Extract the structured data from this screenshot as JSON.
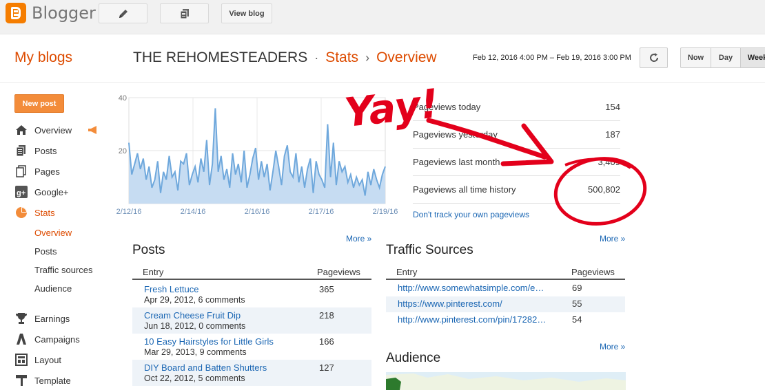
{
  "app": {
    "name": "Blogger"
  },
  "toolbar": {
    "view_blog": "View blog",
    "pencil_icon": "pencil-icon",
    "pages_icon": "pages-icon"
  },
  "header": {
    "my_blogs": "My blogs",
    "blog_name": "THE REHOMESTEADERS",
    "sep1": "·",
    "section": "Stats",
    "sep2": "›",
    "page": "Overview",
    "date_range": "Feb 12, 2016 4:00 PM – Feb 19, 2016 3:00 PM",
    "periods": {
      "now": "Now",
      "day": "Day",
      "week": "Week"
    }
  },
  "sidebar": {
    "new_post": "New post",
    "items": [
      {
        "label": "Overview",
        "icon": "home-icon"
      },
      {
        "label": "Posts",
        "icon": "posts-icon"
      },
      {
        "label": "Pages",
        "icon": "pages-icon"
      },
      {
        "label": "Google+",
        "icon": "google-plus-icon"
      },
      {
        "label": "Stats",
        "icon": "pie-chart-icon"
      }
    ],
    "stats_sub": [
      "Overview",
      "Posts",
      "Traffic sources",
      "Audience"
    ],
    "items2": [
      {
        "label": "Earnings",
        "icon": "trophy-icon"
      },
      {
        "label": "Campaigns",
        "icon": "campaigns-icon"
      },
      {
        "label": "Layout",
        "icon": "layout-icon"
      },
      {
        "label": "Template",
        "icon": "template-icon"
      }
    ]
  },
  "chart_data": {
    "type": "area",
    "x_labels": [
      "2/12/16",
      "2/14/16",
      "2/16/16",
      "2/17/16",
      "2/19/16"
    ],
    "y_ticks": [
      40,
      20
    ],
    "ylim": [
      0,
      40
    ],
    "color": "#6fa8dc",
    "values": [
      23,
      11,
      15,
      19,
      13,
      17,
      9,
      14,
      6,
      9,
      16,
      4,
      12,
      9,
      18,
      10,
      12,
      5,
      16,
      15,
      19,
      7,
      11,
      14,
      8,
      17,
      12,
      24,
      7,
      15,
      36,
      12,
      18,
      9,
      13,
      6,
      19,
      11,
      15,
      8,
      20,
      6,
      11,
      17,
      21,
      9,
      16,
      10,
      15,
      5,
      12,
      20,
      14,
      7,
      18,
      22,
      12,
      10,
      19,
      8,
      14,
      6,
      13,
      17,
      4,
      16,
      11,
      9,
      6,
      30,
      10,
      23,
      7,
      16,
      12,
      14,
      8,
      11,
      6,
      10,
      7,
      9,
      3,
      12,
      7,
      13,
      9,
      6,
      11,
      14
    ]
  },
  "stats": [
    {
      "label": "Pageviews today",
      "value": "154"
    },
    {
      "label": "Pageviews yesterday",
      "value": "187"
    },
    {
      "label": "Pageviews last month",
      "value": "3,409"
    },
    {
      "label": "Pageviews all time history",
      "value": "500,802"
    }
  ],
  "dont_track": "Don't track your own pageviews",
  "more": "More »",
  "posts": {
    "title": "Posts",
    "col_entry": "Entry",
    "col_pageviews": "Pageviews",
    "rows": [
      {
        "title": "Fresh Lettuce",
        "meta": "Apr 29, 2012, 6 comments",
        "views": "365"
      },
      {
        "title": "Cream Cheese Fruit Dip",
        "meta": "Jun 18, 2012, 0 comments",
        "views": "218"
      },
      {
        "title": "10 Easy Hairstyles for Little Girls",
        "meta": "Mar 29, 2013, 9 comments",
        "views": "166"
      },
      {
        "title": "DIY Board and Batten Shutters",
        "meta": "Oct 22, 2012, 5 comments",
        "views": "127"
      }
    ]
  },
  "traffic": {
    "title": "Traffic Sources",
    "col_entry": "Entry",
    "col_pageviews": "Pageviews",
    "rows": [
      {
        "url": "http://www.somewhatsimple.com/e…",
        "views": "69"
      },
      {
        "url": "https://www.pinterest.com/",
        "views": "55"
      },
      {
        "url": "http://www.pinterest.com/pin/17282…",
        "views": "54"
      }
    ]
  },
  "audience": {
    "title": "Audience"
  },
  "annotation": {
    "text": "Yay!",
    "color": "#e3001b"
  }
}
